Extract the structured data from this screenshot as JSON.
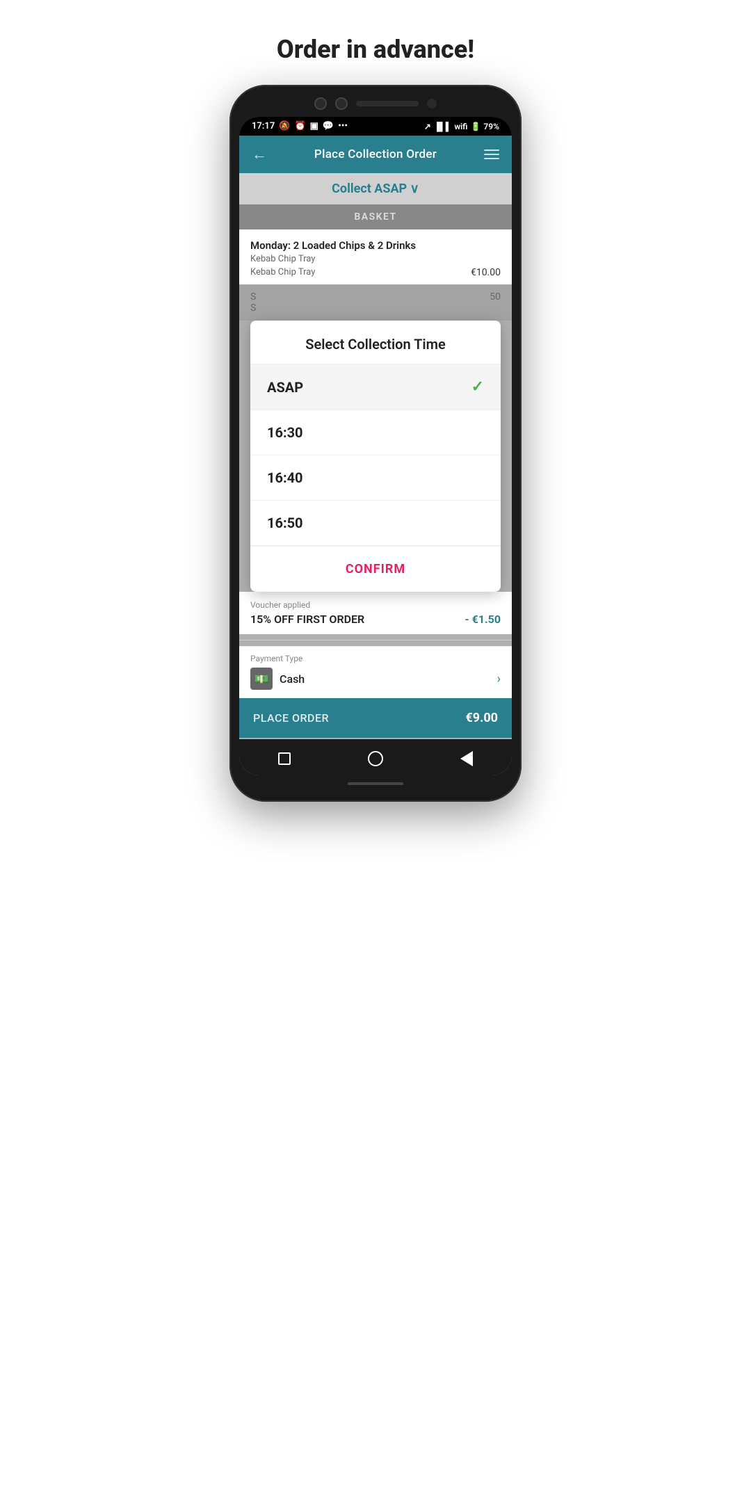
{
  "page": {
    "title": "Order in advance!"
  },
  "statusBar": {
    "time": "17:17",
    "battery": "79%"
  },
  "header": {
    "title": "Place Collection Order",
    "backLabel": "←",
    "menuLabel": "≡"
  },
  "collectBar": {
    "text": "Collect ASAP",
    "chevron": "∨"
  },
  "basket": {
    "label": "BASKET",
    "itemName": "Monday: 2 Loaded Chips & 2 Drinks",
    "subItem1": "Kebab Chip Tray",
    "subItem2": "Kebab Chip Tray",
    "price": "€10.00",
    "dimLine1": "S",
    "dimLine2": "S",
    "dimPrice": "50"
  },
  "modal": {
    "title": "Select Collection Time",
    "options": [
      {
        "label": "ASAP",
        "selected": true
      },
      {
        "label": "16:30",
        "selected": false
      },
      {
        "label": "16:40",
        "selected": false
      },
      {
        "label": "16:50",
        "selected": false
      }
    ],
    "confirmLabel": "CONFIRM"
  },
  "voucher": {
    "label": "Voucher applied",
    "name": "15% OFF FIRST ORDER",
    "discount": "- €1.50"
  },
  "payment": {
    "label": "Payment Type",
    "method": "Cash",
    "icon": "💵"
  },
  "placeOrder": {
    "label": "PLACE ORDER",
    "price": "€9.00"
  },
  "nav": {
    "square": "",
    "circle": "",
    "triangle": ""
  }
}
